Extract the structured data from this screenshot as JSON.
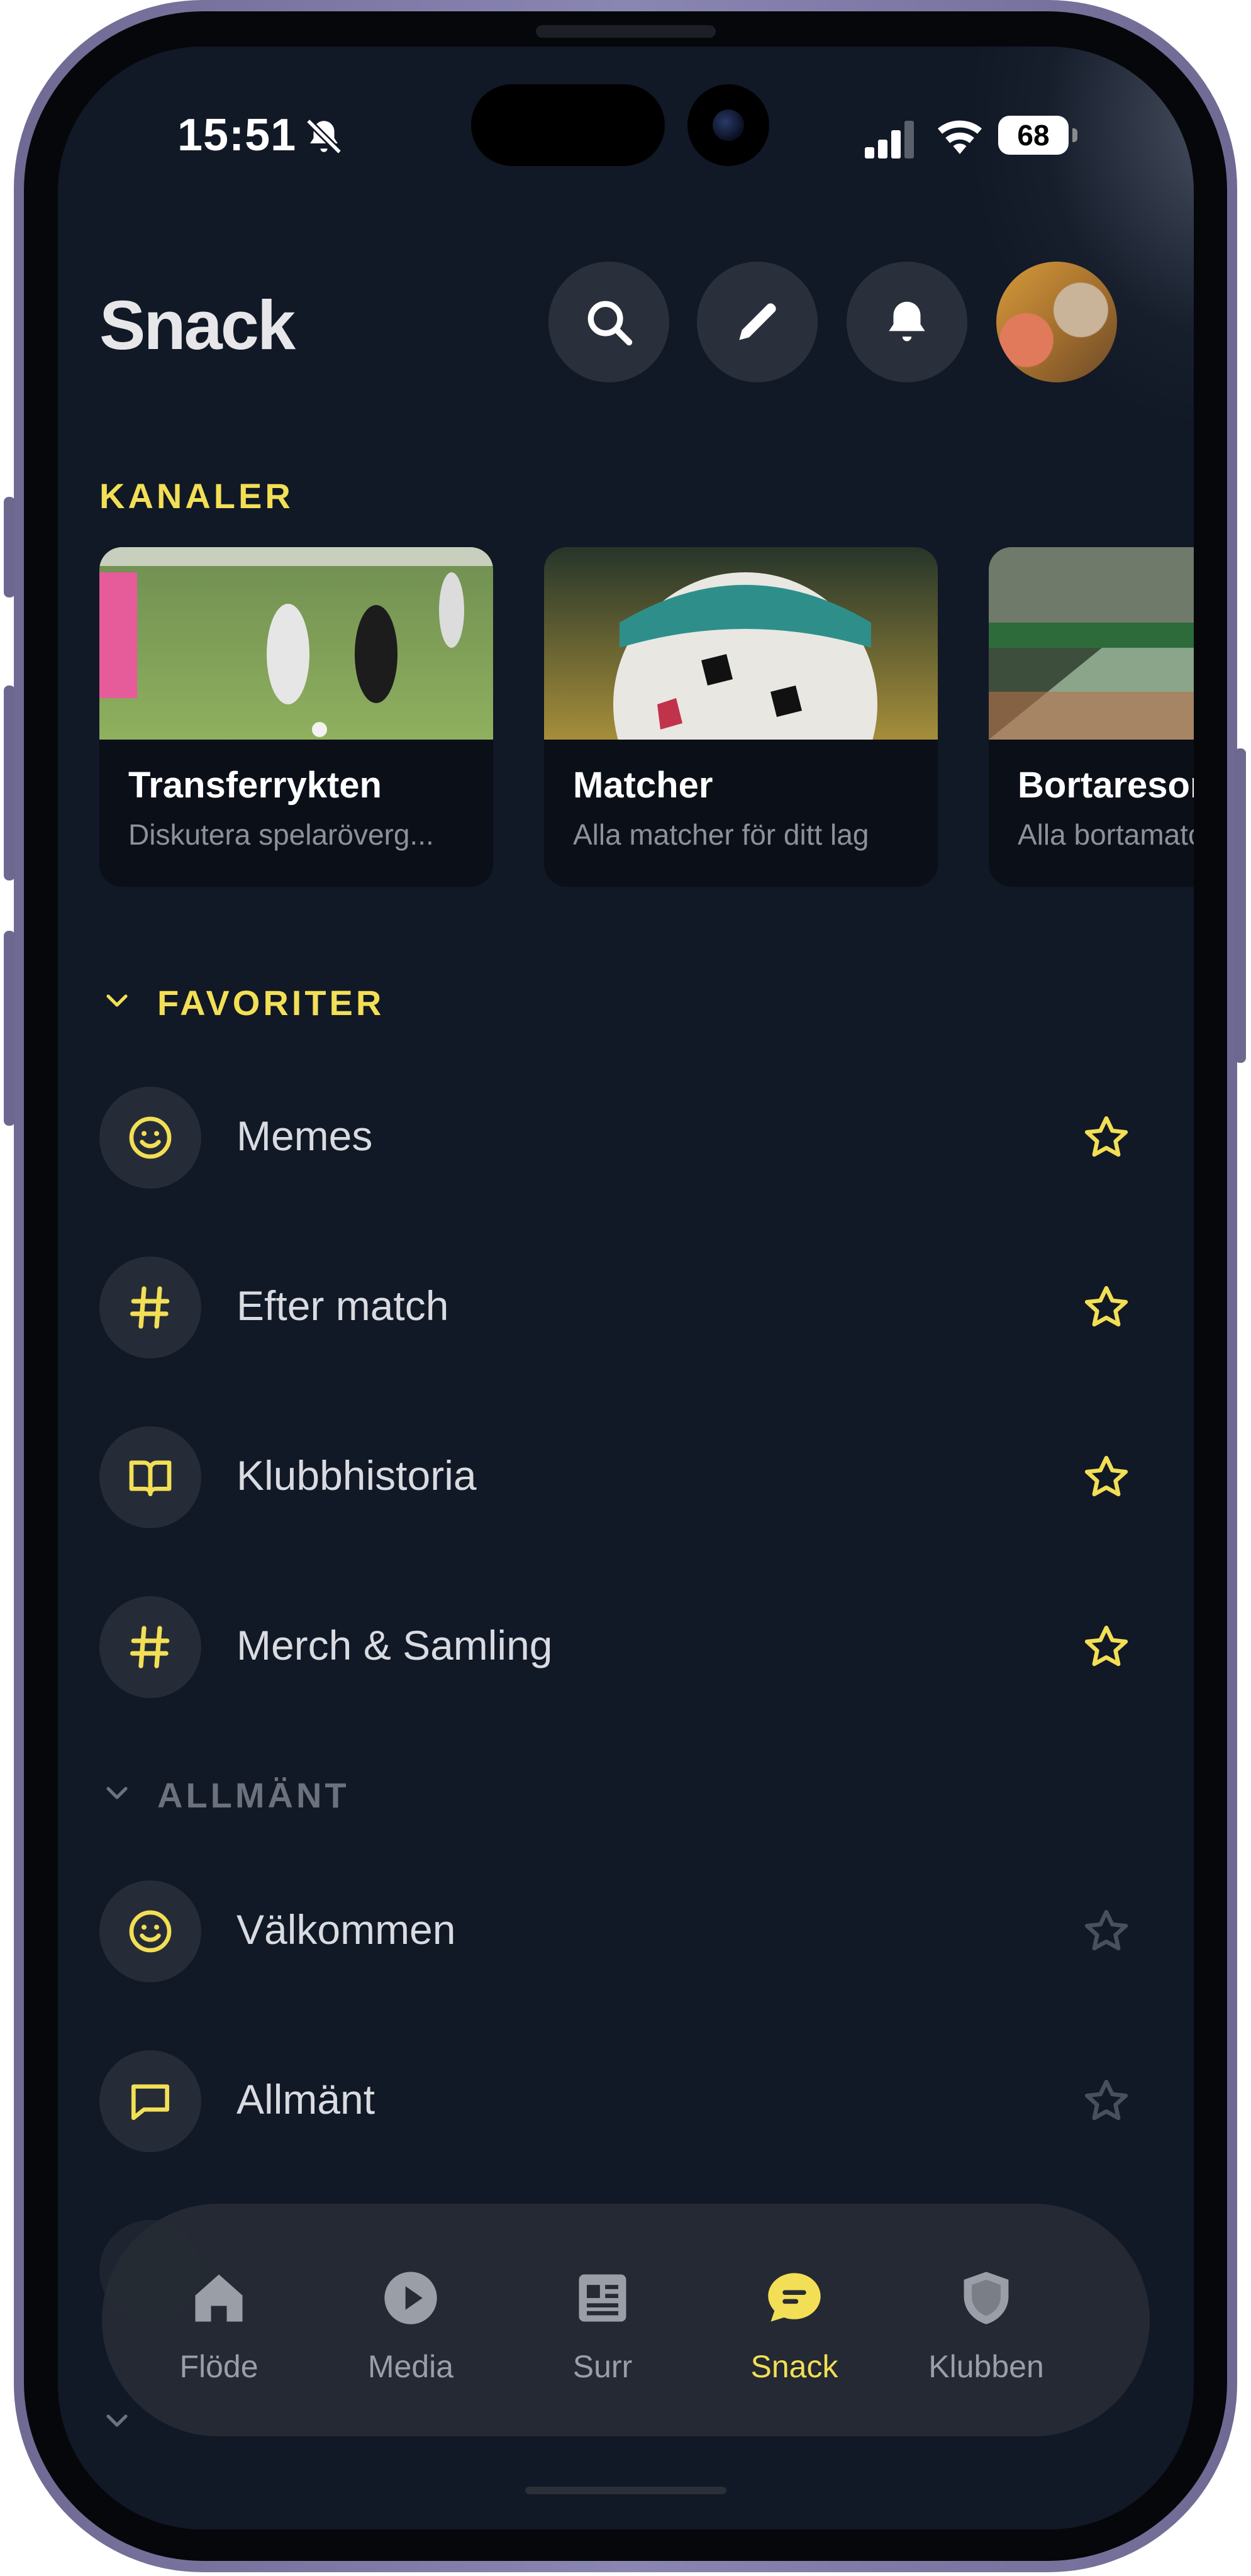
{
  "status_bar": {
    "time": "15:51",
    "battery": "68"
  },
  "header": {
    "title": "Snack"
  },
  "channels": {
    "label": "KANALER",
    "cards": [
      {
        "title": "Transferrykten",
        "desc": "Diskutera spelaröverg..."
      },
      {
        "title": "Matcher",
        "desc": "Alla matcher för ditt lag"
      },
      {
        "title": "Bortaresor",
        "desc": "Alla bortamatcher"
      }
    ]
  },
  "favorites": {
    "label": "FAVORITER",
    "items": [
      {
        "label": "Memes",
        "icon": "smiley-icon"
      },
      {
        "label": "Efter match",
        "icon": "hashtag-icon"
      },
      {
        "label": "Klubbhistoria",
        "icon": "book-icon"
      },
      {
        "label": "Merch & Samling",
        "icon": "hashtag-icon"
      }
    ]
  },
  "general": {
    "label": "ALLMÄNT",
    "items": [
      {
        "label": "Välkommen",
        "icon": "smiley-icon"
      },
      {
        "label": "Allmänt",
        "icon": "chat-bubble-icon"
      }
    ]
  },
  "bottom_nav": {
    "items": [
      {
        "label": "Flöde",
        "icon": "home-icon"
      },
      {
        "label": "Media",
        "icon": "play-icon"
      },
      {
        "label": "Surr",
        "icon": "newspaper-icon"
      },
      {
        "label": "Snack",
        "icon": "chat-icon",
        "active": true
      },
      {
        "label": "Klubben",
        "icon": "shield-icon"
      }
    ]
  },
  "colors": {
    "accent": "#f2df55",
    "background": "#111826",
    "muted": "#9a9ea7"
  }
}
